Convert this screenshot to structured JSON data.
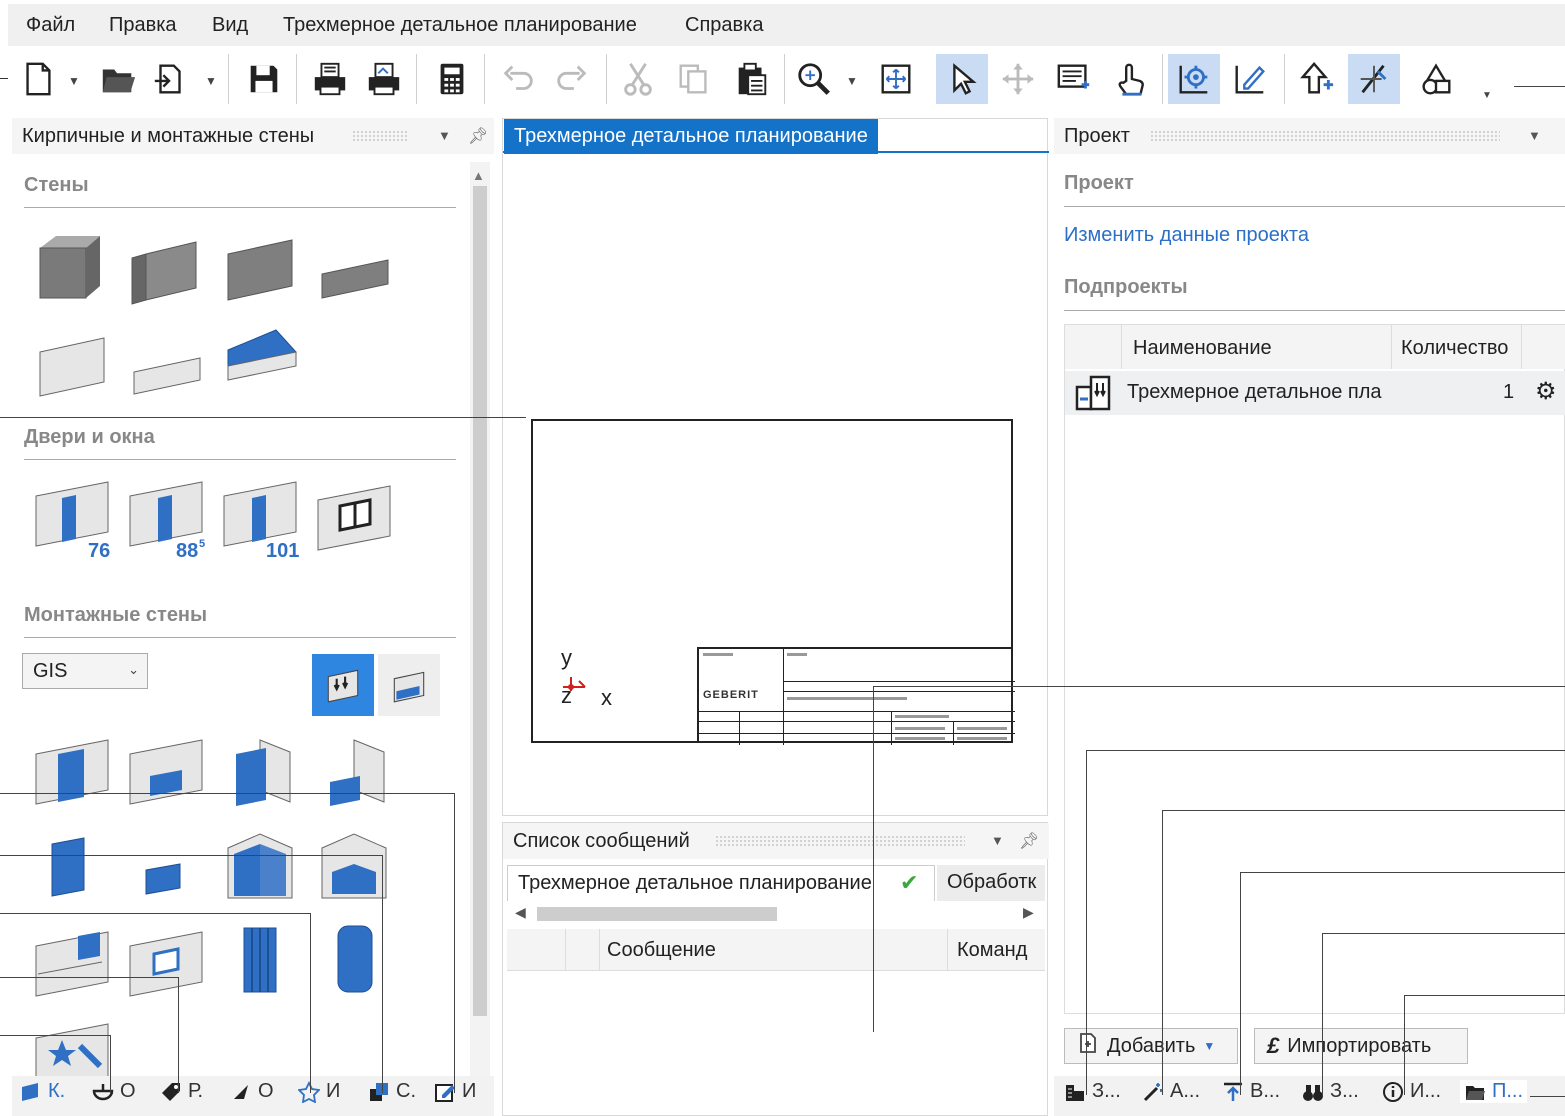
{
  "menu": {
    "file": "Файл",
    "edit": "Правка",
    "view": "Вид",
    "planning": "Трехмерное детальное планирование",
    "help": "Справка"
  },
  "toolbar": {
    "icons": [
      "new-document-icon",
      "open-folder-icon",
      "import-icon",
      "save-icon",
      "print-icon",
      "print-preview-icon",
      "calculator-icon",
      "undo-icon",
      "redo-icon",
      "cut-icon",
      "copy-icon",
      "paste-icon",
      "zoom-icon",
      "fit-view-icon",
      "select-pointer-icon",
      "move-icon",
      "property-icon",
      "touch-icon",
      "settings-grid-icon",
      "edit-measure-icon",
      "up-plus-icon",
      "snap-icon",
      "shapes-icon"
    ]
  },
  "left_panel": {
    "title": "Кирпичные и монтажные стены",
    "sections": {
      "walls": "Стены",
      "doors": "Двери и окна",
      "mounting": "Монтажные стены"
    },
    "door_labels": [
      "76",
      "88",
      "5",
      "101"
    ],
    "system_select": {
      "value": "GIS"
    },
    "bottom_tabs": [
      "К.",
      "О",
      "Р.",
      "О",
      "И",
      "С.",
      "И"
    ]
  },
  "center_panel": {
    "tab": "Трехмерное детальное планирование",
    "axes": {
      "y": "y",
      "z": "z",
      "x": "x"
    },
    "brand": "GEBERIT"
  },
  "messages_panel": {
    "title": "Список сообщений",
    "tabs": [
      "Трехмерное детальное планирование",
      "Обработк"
    ],
    "columns": [
      "Сообщение",
      "Команд"
    ]
  },
  "right_panel": {
    "title": "Проект",
    "section_project": "Проект",
    "edit_link": "Изменить данные проекта",
    "section_subprojects": "Подпроекты",
    "columns": {
      "name": "Наименование",
      "qty": "Количество"
    },
    "rows": [
      {
        "name": "Трехмерное детальное пла",
        "qty": "1"
      }
    ],
    "add_button": "Добавить",
    "import_button": "Импортировать",
    "bottom_tabs": [
      "З...",
      "А...",
      "В...",
      "З...",
      "И...",
      "П..."
    ]
  },
  "colors": {
    "accent": "#1473c9",
    "wall_blue": "#2f6fc4",
    "wall_grey": "#8a8a8a"
  }
}
